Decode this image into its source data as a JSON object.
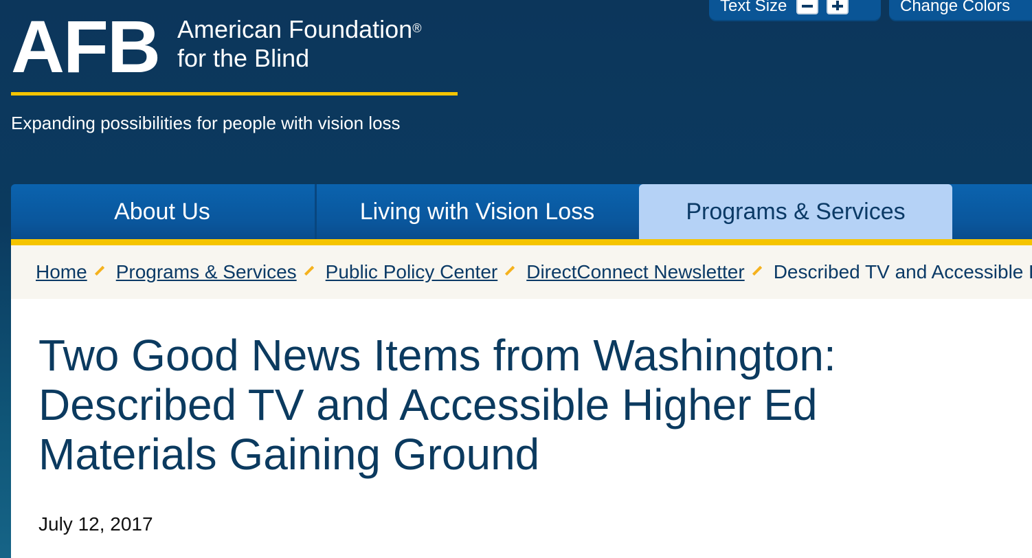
{
  "utility": {
    "text_size_label": "Text Size",
    "decrease_icon": "minus-icon",
    "increase_icon": "plus-icon",
    "change_colors_label": "Change Colors"
  },
  "logo": {
    "mark": "AFB",
    "name_line1": "American Foundation",
    "registered": "®",
    "name_line2": "for the Blind"
  },
  "tagline": "Expanding possibilities for people with vision loss",
  "nav": {
    "items": [
      {
        "label": "About Us"
      },
      {
        "label": "Living with Vision Loss"
      },
      {
        "label": "Programs & Services",
        "active": true
      }
    ]
  },
  "breadcrumb": {
    "items": [
      {
        "label": "Home"
      },
      {
        "label": "Programs & Services"
      },
      {
        "label": "Public Policy Center"
      },
      {
        "label": "DirectConnect Newsletter"
      }
    ],
    "current": "Described TV and Accessible Higher Ed Materials Gaining Ground"
  },
  "article": {
    "title": "Two Good News Items from Washington: Described TV and Accessible Higher Ed Materials Gaining Ground",
    "date": "July 12, 2017"
  },
  "colors": {
    "header_bg": "#0c365b",
    "nav_blue": "#0a569c",
    "nav_active": "#b5d2f6",
    "accent_yellow": "#f5c400",
    "chevron_orange": "#f5b21e",
    "title_text": "#0b3a5f"
  }
}
